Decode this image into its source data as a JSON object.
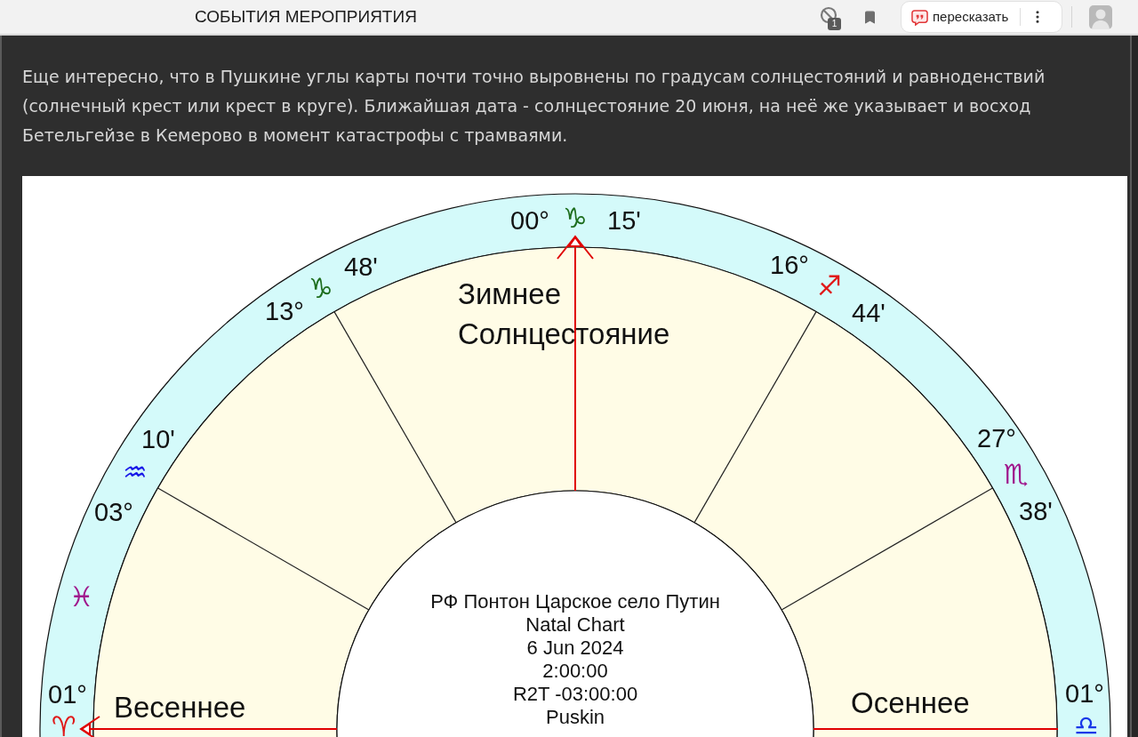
{
  "browser_bar": {
    "page_title": "СОБЫТИЯ МЕРОПРИЯТИЯ",
    "counter_badge": "1",
    "retell_button": "пересказать"
  },
  "article": {
    "paragraph_lines": [
      "Еще интересно, что в Пушкине углы карты почти точно выровнены по градусам солнцестояний и равноденствий",
      "(солнечный крест или крест в круге). Ближайшая дата - солнцестояние 20 июня, на неё же указывает и восход",
      "Бетельгейзе в Кемерово в момент катастрофы с трамваями."
    ]
  },
  "natal_chart": {
    "zodiac_labels": [
      {
        "degree": "00°",
        "sign": "♑",
        "minutes": "15'",
        "color": "#1e6e1e"
      },
      {
        "degree": "13°",
        "sign": "♑",
        "minutes": "48'",
        "color": "#1e6e1e"
      },
      {
        "degree": "16°",
        "sign": "♐",
        "minutes": "44'",
        "color": "#e01818"
      },
      {
        "minutes": "10'",
        "sign": "♒",
        "degree": "03°",
        "color": "#1818e8"
      },
      {
        "degree": "27°",
        "sign": "♏",
        "minutes": "38'",
        "color": "#a0188c"
      },
      {
        "sign": "♓",
        "color": "#a0188c"
      },
      {
        "degree": "01°",
        "sign": "♈",
        "color": "#e01818"
      },
      {
        "degree": "01°",
        "sign": "♎",
        "color": "#1838e8"
      }
    ],
    "season_labels": [
      {
        "lines": [
          "Зимнее",
          "Солнцестояние"
        ]
      },
      {
        "lines": [
          "Весеннее"
        ]
      },
      {
        "lines": [
          "Осеннее"
        ]
      }
    ],
    "info_lines": [
      "РФ Понтон Царское село Путин",
      "Natal Chart",
      "6 Jun 2024",
      "2:00:00",
      "R2T -03:00:00",
      "Puskin"
    ]
  }
}
